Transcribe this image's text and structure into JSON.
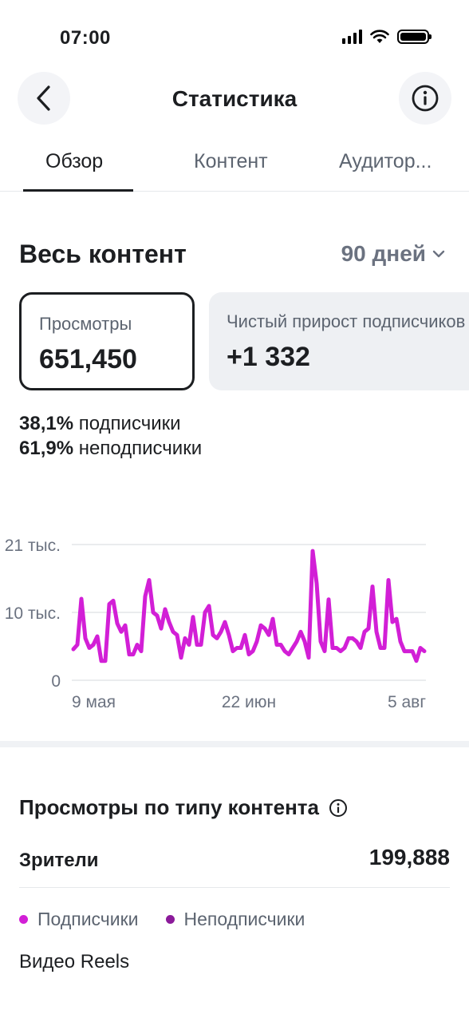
{
  "status_bar": {
    "time": "07:00"
  },
  "header": {
    "title": "Статистика",
    "back_icon": "chevron-left-icon",
    "info_icon": "info-icon"
  },
  "tabs": [
    {
      "label": "Обзор",
      "active": true
    },
    {
      "label": "Контент",
      "active": false
    },
    {
      "label": "Аудитор...",
      "active": false
    }
  ],
  "overview": {
    "title": "Весь контент",
    "period": "90 дней",
    "cards": [
      {
        "label": "Просмотры",
        "value": "651,450",
        "selected": true
      },
      {
        "label": "Чистый прирост подписчиков",
        "value": "+1 332",
        "selected": false
      }
    ],
    "shares": [
      {
        "percent": "38,1%",
        "label": "подписчики"
      },
      {
        "percent": "61,9%",
        "label": "неподписчики"
      }
    ]
  },
  "chart_data": {
    "type": "line",
    "x_ticks": [
      "9 мая",
      "22 июн",
      "5 авг"
    ],
    "y_ticks": [
      "21 тыс.",
      "10 тыс.",
      "0"
    ],
    "ylim": [
      0,
      21000
    ],
    "grid": true,
    "color": "#d21fd6",
    "series": [
      {
        "values": [
          4800,
          5500,
          12600,
          6500,
          5000,
          5500,
          6800,
          3000,
          3000,
          11800,
          12300,
          8800,
          7500,
          8500,
          4000,
          4000,
          5500,
          4500,
          13000,
          15500,
          10500,
          10000,
          8000,
          11000,
          9000,
          7500,
          7000,
          3500,
          6500,
          5500,
          9800,
          5500,
          5500,
          10500,
          11500,
          7000,
          6500,
          7500,
          9000,
          7000,
          4500,
          5000,
          5000,
          7000,
          4000,
          4500,
          6000,
          8500,
          8000,
          7000,
          9500,
          5500,
          5500,
          4500,
          4000,
          5000,
          6000,
          7500,
          6000,
          3500,
          20000,
          15000,
          6000,
          4500,
          12500,
          5000,
          5000,
          4500,
          5000,
          6500,
          6500,
          6000,
          5000,
          7500,
          8000,
          14500,
          7500,
          5000,
          5000,
          15500,
          9000,
          9500,
          6000,
          4500,
          4500,
          4500,
          3000,
          5000,
          4500
        ]
      }
    ]
  },
  "breakdown": {
    "title": "Просмотры по типу контента",
    "viewers_label": "Зрители",
    "viewers_value": "199,888",
    "legend": [
      {
        "label": "Подписчики",
        "color": "#d21fd6"
      },
      {
        "label": "Неподписчики",
        "color": "#8b1a9a"
      }
    ],
    "category": "Видео Reels"
  }
}
